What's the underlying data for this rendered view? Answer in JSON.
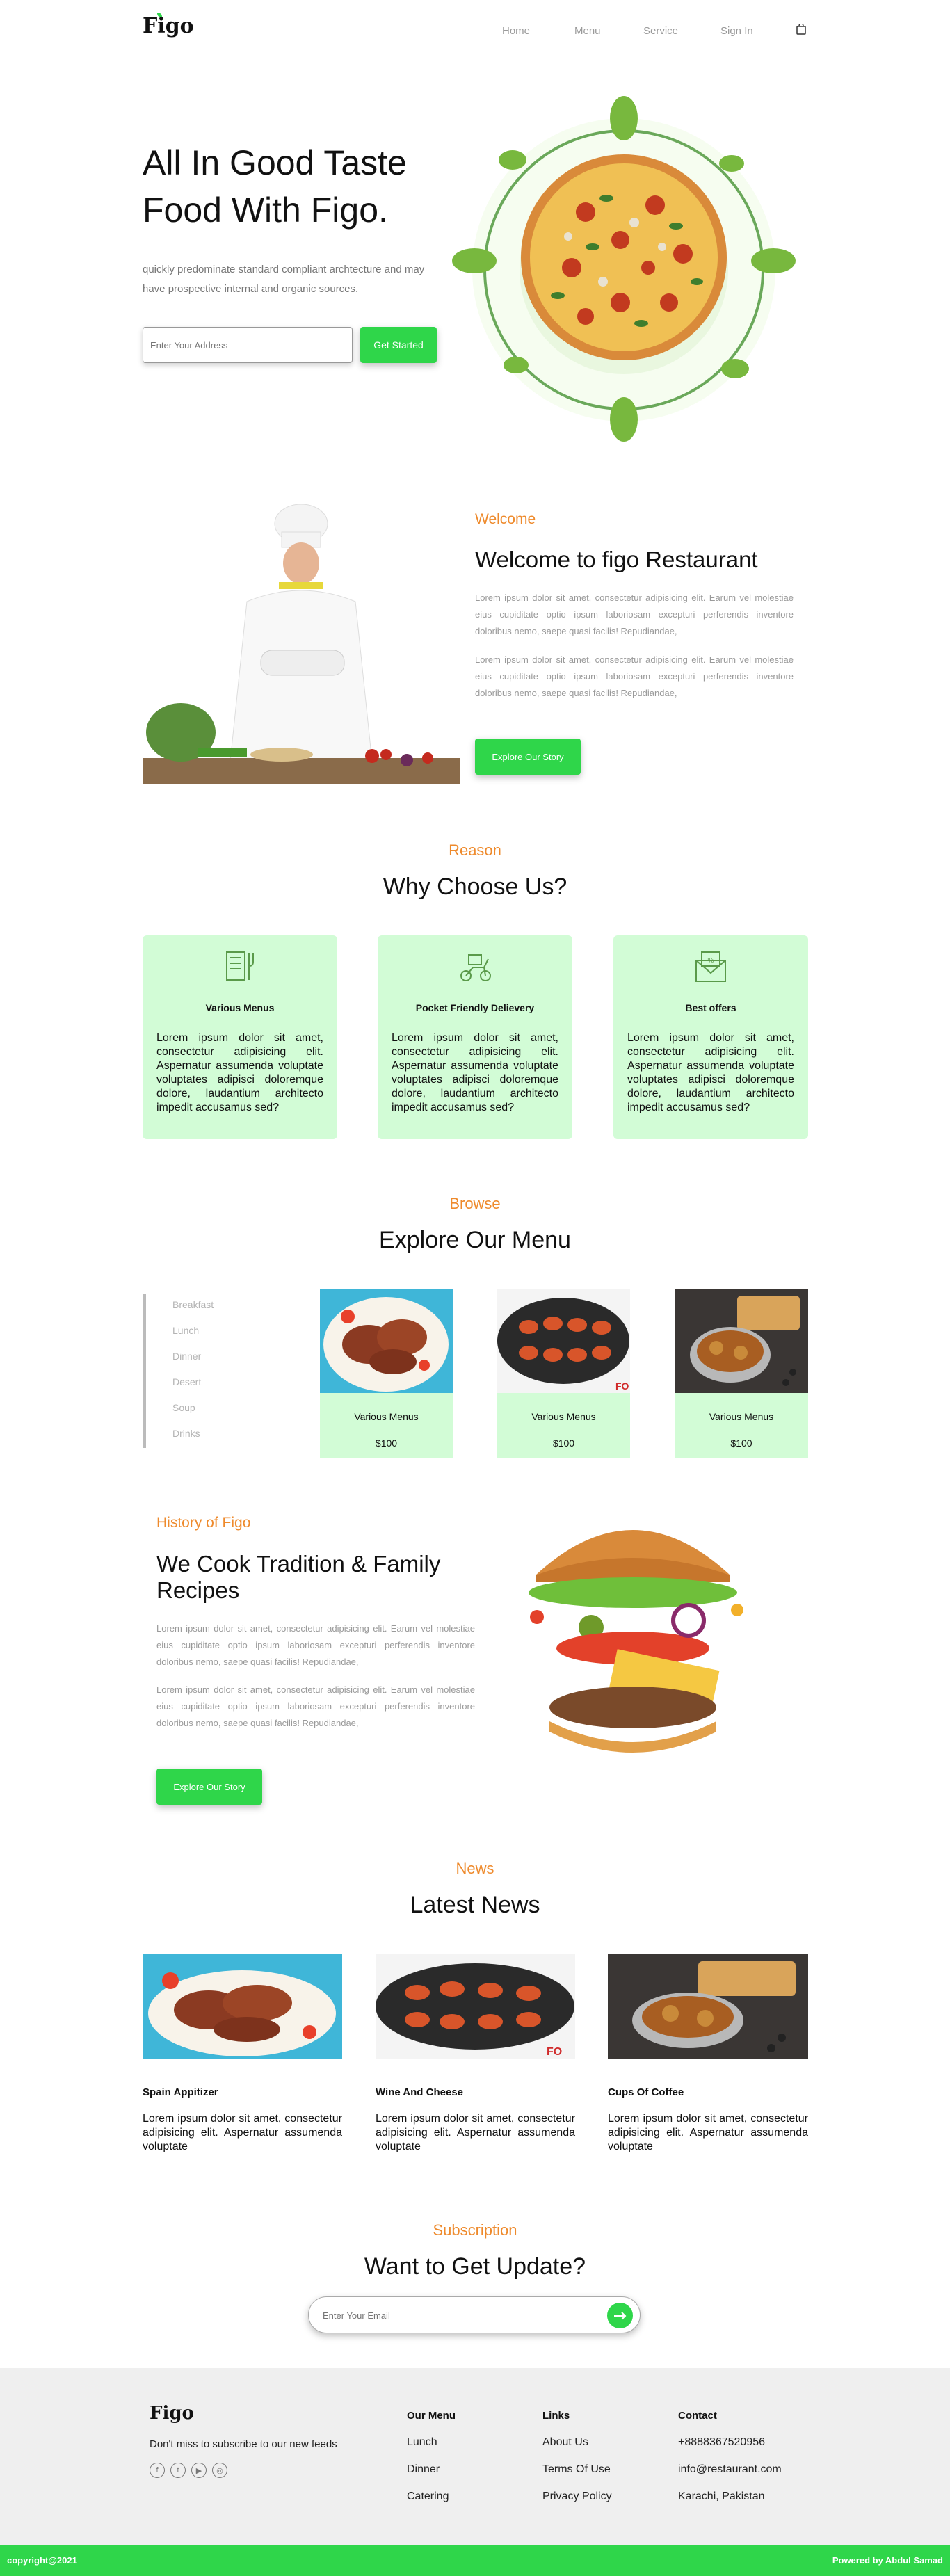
{
  "header": {
    "logo": "Figo",
    "nav": [
      "Home",
      "Menu",
      "Service",
      "Sign In"
    ]
  },
  "hero": {
    "title_line1": "All In Good Taste",
    "title_line2": "Food With Figo.",
    "subtitle": "quickly predominate standard compliant archtecture and may have prospective internal and organic sources.",
    "address_placeholder": "Enter Your Address",
    "cta": "Get Started"
  },
  "welcome": {
    "label": "Welcome",
    "title": "Welcome to figo Restaurant",
    "para1": "Lorem ipsum dolor sit amet, consectetur adipisicing elit. Earum vel molestiae eius cupiditate optio ipsum laboriosam excepturi perferendis inventore doloribus nemo, saepe quasi facilis! Repudiandae,",
    "para2": "Lorem ipsum dolor sit amet, consectetur adipisicing elit. Earum vel molestiae eius cupiditate optio ipsum laboriosam excepturi perferendis inventore doloribus nemo, saepe quasi facilis! Repudiandae,",
    "cta": "Explore Our Story"
  },
  "reason": {
    "label": "Reason",
    "title": "Why Choose Us?",
    "cards": [
      {
        "icon": "menu-icon",
        "title": "Various Menus",
        "text": "Lorem ipsum dolor sit amet, consectetur adipisicing elit. Aspernatur assumenda voluptate voluptates adipisci doloremque dolore, laudantium architecto impedit accusamus sed?"
      },
      {
        "icon": "delivery-scooter-icon",
        "title": "Pocket Friendly Delievery",
        "text": "Lorem ipsum dolor sit amet, consectetur adipisicing elit. Aspernatur assumenda voluptate voluptates adipisci doloremque dolore, laudantium architecto impedit accusamus sed?"
      },
      {
        "icon": "offer-envelope-icon",
        "title": "Best offers",
        "text": "Lorem ipsum dolor sit amet, consectetur adipisicing elit. Aspernatur assumenda voluptate voluptates adipisci doloremque dolore, laudantium architecto impedit accusamus sed?"
      }
    ]
  },
  "browse": {
    "label": "Browse",
    "title": "Explore Our Menu",
    "categories": [
      "Breakfast",
      "Lunch",
      "Dinner",
      "Desert",
      "Soup",
      "Drinks"
    ],
    "items": [
      {
        "name": "Various Menus",
        "price": "$100"
      },
      {
        "name": "Various Menus",
        "price": "$100"
      },
      {
        "name": "Various Menus",
        "price": "$100"
      }
    ]
  },
  "history": {
    "label": "History of Figo",
    "title_line1": "We Cook Tradition & Family",
    "title_line2": "Recipes",
    "para1": "Lorem ipsum dolor sit amet, consectetur adipisicing elit. Earum vel molestiae eius cupiditate optio ipsum laboriosam excepturi perferendis inventore doloribus nemo, saepe quasi facilis! Repudiandae,",
    "para2": "Lorem ipsum dolor sit amet, consectetur adipisicing elit. Earum vel molestiae eius cupiditate optio ipsum laboriosam excepturi perferendis inventore doloribus nemo, saepe quasi facilis! Repudiandae,",
    "cta": "Explore Our Story"
  },
  "news": {
    "label": "News",
    "title": "Latest News",
    "items": [
      {
        "title": "Spain Appitizer",
        "text": "Lorem ipsum dolor sit amet, consectetur adipisicing elit. Aspernatur assumenda voluptate"
      },
      {
        "title": "Wine And Cheese",
        "text": "Lorem ipsum dolor sit amet, consectetur adipisicing elit. Aspernatur assumenda voluptate"
      },
      {
        "title": "Cups Of Coffee",
        "text": "Lorem ipsum dolor sit amet, consectetur adipisicing elit. Aspernatur assumenda voluptate"
      }
    ]
  },
  "subscription": {
    "label": "Subscription",
    "title": "Want to Get Update?",
    "email_placeholder": "Enter Your Email"
  },
  "footer": {
    "logo": "Figo",
    "tagline": "Don't miss to subscribe to our new feeds",
    "menu_heading": "Our Menu",
    "menu_links": [
      "Lunch",
      "Dinner",
      "Catering"
    ],
    "links_heading": "Links",
    "links": [
      "About Us",
      "Terms Of Use",
      "Privacy Policy"
    ],
    "contact_heading": "Contact",
    "contact": [
      "+8888367520956",
      "info@restaurant.com",
      "Karachi, Pakistan"
    ],
    "copyright": "copyright@2021",
    "powered": "Powered by Abdul Samad"
  },
  "colors": {
    "accent": "#2fd64a",
    "label": "#ee8a2c",
    "card": "#d2fcd6",
    "footer_bg": "#efefef"
  }
}
